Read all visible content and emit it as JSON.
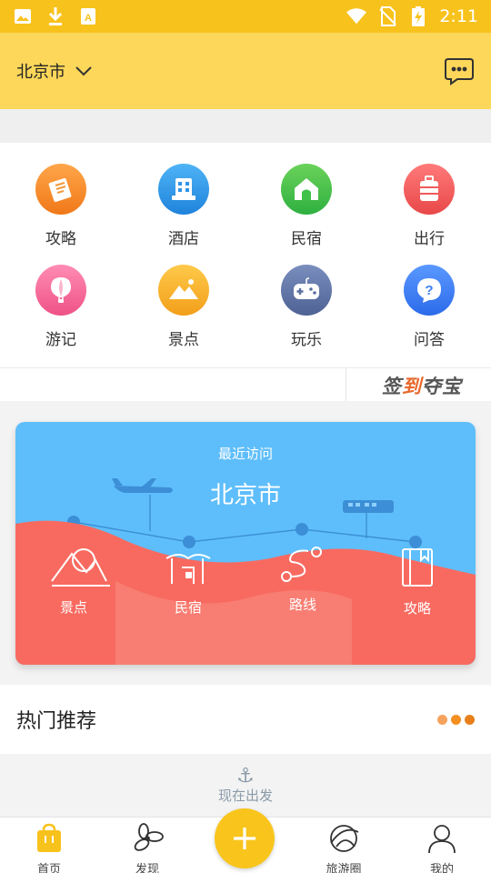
{
  "status_bar": {
    "time": "2:11",
    "left_icons": [
      "image-icon",
      "download-icon",
      "app-store-icon"
    ],
    "right_icons": [
      "wifi-icon",
      "no-sim-icon",
      "battery-charging-icon"
    ]
  },
  "header": {
    "city": "北京市",
    "accent": "#fdd75a"
  },
  "categories": [
    {
      "label": "攻略",
      "icon": "guide-book-icon",
      "color": "#f7902a"
    },
    {
      "label": "酒店",
      "icon": "hotel-icon",
      "color": "#2f95e8"
    },
    {
      "label": "民宿",
      "icon": "homestay-icon",
      "color": "#3fc14a"
    },
    {
      "label": "出行",
      "icon": "luggage-icon",
      "color": "#f05a5a"
    },
    {
      "label": "游记",
      "icon": "balloon-icon",
      "color": "#f36a9a"
    },
    {
      "label": "景点",
      "icon": "mountain-icon",
      "color": "#f8b22c"
    },
    {
      "label": "玩乐",
      "icon": "gamepad-icon",
      "color": "#5a6fa0"
    },
    {
      "label": "问答",
      "icon": "question-icon",
      "color": "#3b7ef0"
    }
  ],
  "sign_in": {
    "text_a": "签",
    "text_b": "到",
    "text_c": "夺宝"
  },
  "recent_card": {
    "title": "最近访问",
    "city": "北京市",
    "items": [
      {
        "label": "景点",
        "icon": "mountain-icon"
      },
      {
        "label": "民宿",
        "icon": "homestay-icon"
      },
      {
        "label": "路线",
        "icon": "route-icon"
      },
      {
        "label": "攻略",
        "icon": "guide-book-icon"
      }
    ],
    "sky_color": "#5ebefb",
    "hill_color": "#f86a60"
  },
  "hot": {
    "title": "热门推荐",
    "dot_colors": [
      "#f6a35e",
      "#f39020",
      "#e8801a"
    ]
  },
  "depart": {
    "text": "现在出发",
    "icon": "anchor-icon"
  },
  "tabbar": {
    "items": [
      {
        "label": "首页",
        "icon": "home-bag-icon"
      },
      {
        "label": "发现",
        "icon": "discover-icon"
      },
      {
        "label": "旅游圈",
        "icon": "planet-icon"
      },
      {
        "label": "我的",
        "icon": "profile-icon"
      }
    ],
    "add_icon": "plus-icon"
  }
}
